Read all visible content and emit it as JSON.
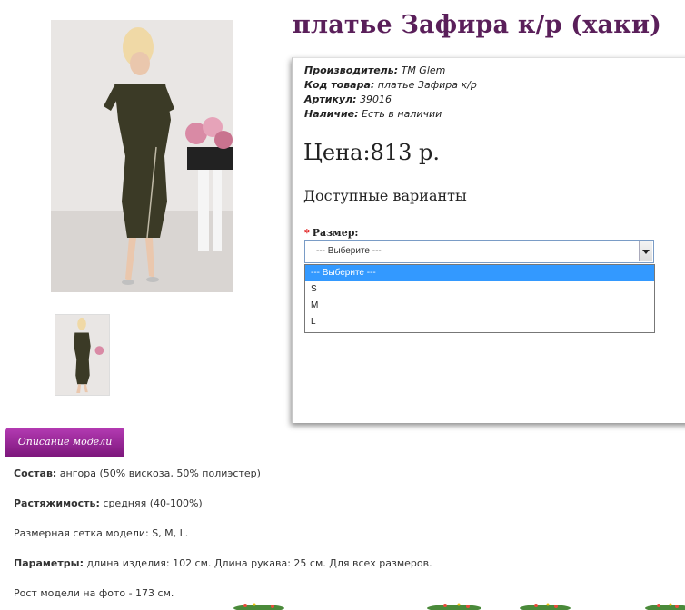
{
  "product": {
    "title": "платье Зафира к/р (хаки)",
    "info": [
      {
        "key": "Производитель:",
        "value": "ТМ Glem"
      },
      {
        "key": "Код товара:",
        "value": "платье Зафира к/р"
      },
      {
        "key": "Артикул:",
        "value": "39016"
      },
      {
        "key": "Наличие:",
        "value": "Есть в наличии"
      }
    ],
    "price": "Цена:813 р.",
    "variants_heading": "Доступные варианты",
    "size": {
      "required_mark": "*",
      "label": "Размер:",
      "selected": "--- Выберите ---",
      "options": [
        "--- Выберите ---",
        "S",
        "M",
        "L"
      ]
    }
  },
  "tabs": [
    {
      "label": "Описание модели",
      "active": true
    }
  ],
  "description": [
    {
      "key": "Состав:",
      "value": " ангора (50% вискоза, 50% полиэстер)"
    },
    {
      "key": "Растяжимость:",
      "value": " средняя (40-100%)"
    },
    {
      "key": "",
      "value": "Размерная сетка модели: S, M, L."
    },
    {
      "key": "Параметры:",
      "value": " длина изделия: 102 см. Длина рукава: 25 см. Для всех размеров."
    },
    {
      "key": "",
      "value": "Рост модели на фото - 173 см."
    }
  ],
  "colors": {
    "title": "#5a1f5a",
    "tab_bg": "#9b2a9a",
    "dropdown_highlight": "#3399ff"
  }
}
